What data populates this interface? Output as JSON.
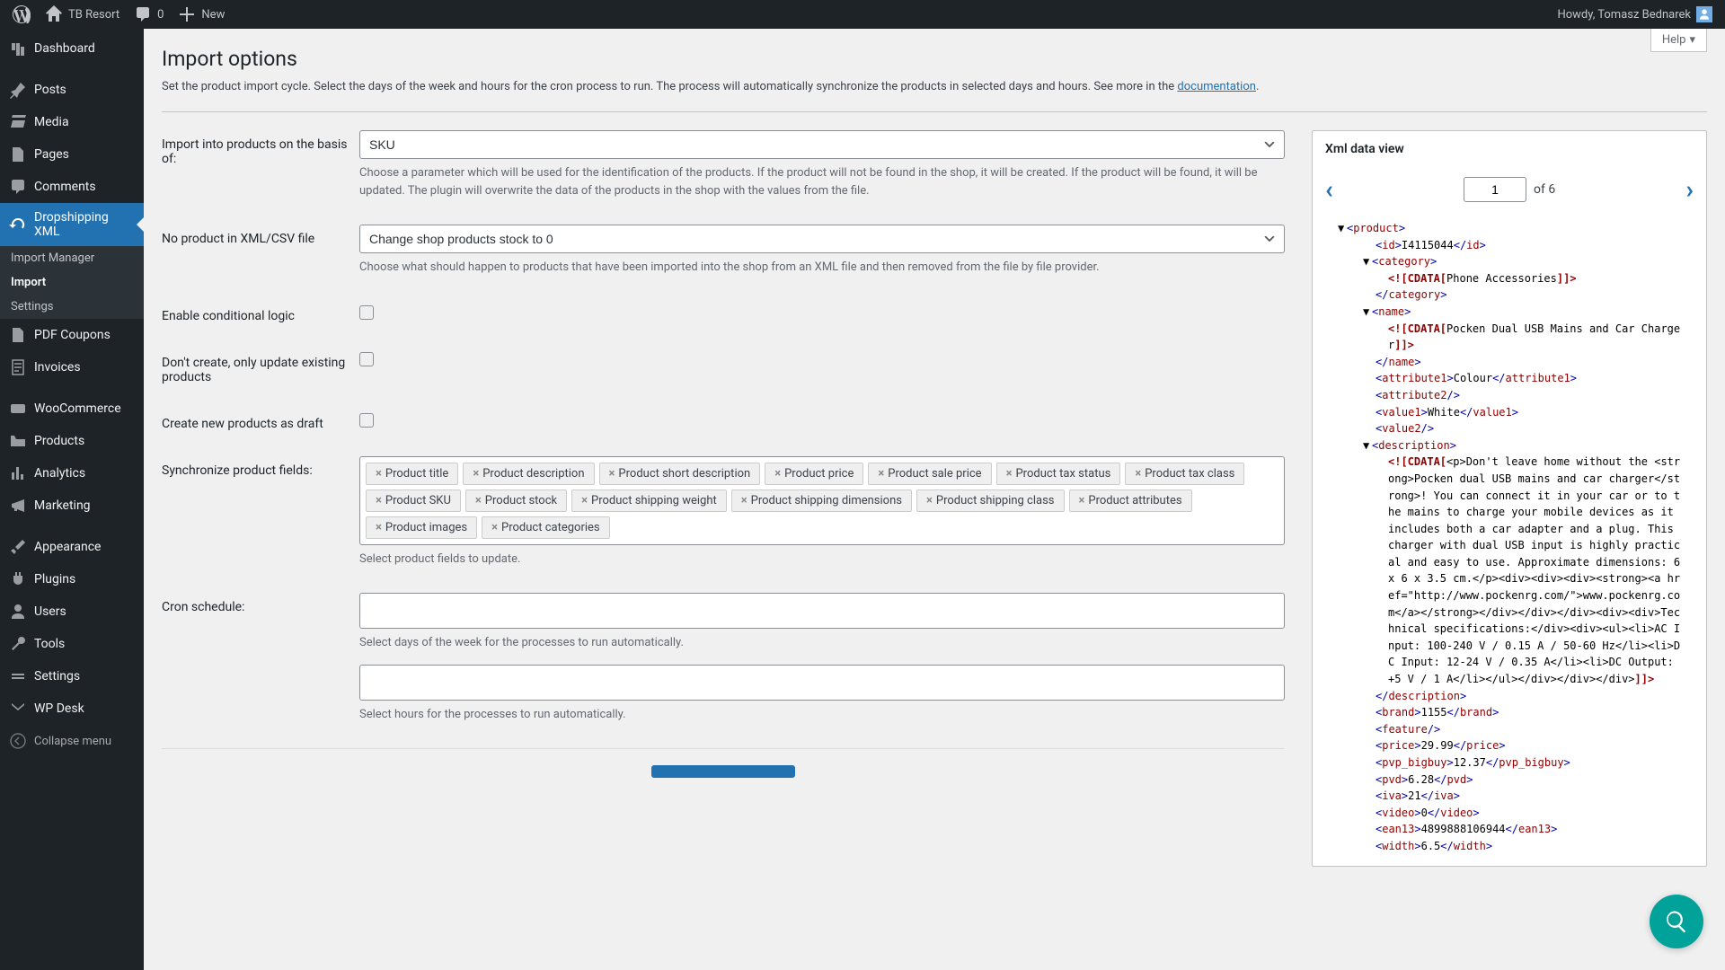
{
  "adminbar": {
    "site_name": "TB Resort",
    "comments_count": "0",
    "new_label": "New",
    "howdy": "Howdy, Tomasz Bednarek"
  },
  "sidebar": {
    "items": [
      {
        "id": "dashboard",
        "label": "Dashboard"
      },
      {
        "id": "posts",
        "label": "Posts"
      },
      {
        "id": "media",
        "label": "Media"
      },
      {
        "id": "pages",
        "label": "Pages"
      },
      {
        "id": "comments",
        "label": "Comments"
      },
      {
        "id": "dropshipping",
        "label": "Dropshipping XML",
        "current": true
      },
      {
        "id": "pdfcoupons",
        "label": "PDF Coupons"
      },
      {
        "id": "invoices",
        "label": "Invoices"
      },
      {
        "id": "woocommerce",
        "label": "WooCommerce"
      },
      {
        "id": "products",
        "label": "Products"
      },
      {
        "id": "analytics",
        "label": "Analytics"
      },
      {
        "id": "marketing",
        "label": "Marketing"
      },
      {
        "id": "appearance",
        "label": "Appearance"
      },
      {
        "id": "plugins",
        "label": "Plugins"
      },
      {
        "id": "users",
        "label": "Users"
      },
      {
        "id": "tools",
        "label": "Tools"
      },
      {
        "id": "settings",
        "label": "Settings"
      },
      {
        "id": "wpdesk",
        "label": "WP Desk"
      }
    ],
    "submenu": [
      {
        "id": "import-manager",
        "label": "Import Manager"
      },
      {
        "id": "import",
        "label": "Import",
        "current": true
      },
      {
        "id": "settings-sub",
        "label": "Settings"
      }
    ],
    "collapse": "Collapse menu"
  },
  "page": {
    "help_label": "Help",
    "title": "Import options",
    "intro_pre": "Set the product import cycle. Select the days of the week and hours for the cron process to run. The process will automatically synchronize the products in selected days and hours. See more in the ",
    "intro_link": "documentation",
    "intro_post": "."
  },
  "form": {
    "basis_label": "Import into products on the basis of:",
    "basis_value": "SKU",
    "basis_help": "Choose a parameter which will be used for the identification of the products. If the product will not be found in the shop, it will be created. If the product will be found, it will be updated. The plugin will overwrite the data of the products in the shop with the values from the file.",
    "noprod_label": "No product in XML/CSV file",
    "noprod_value": "Change shop products stock to 0",
    "noprod_help": "Choose what should happen to products that have been imported into the shop from an XML file and then removed from the file by file provider.",
    "cond_label": "Enable conditional logic",
    "update_label": "Don't create, only update existing products",
    "draft_label": "Create new products as draft",
    "sync_label": "Synchronize product fields:",
    "sync_tags": [
      "Product title",
      "Product description",
      "Product short description",
      "Product price",
      "Product sale price",
      "Product tax status",
      "Product tax class",
      "Product SKU",
      "Product stock",
      "Product shipping weight",
      "Product shipping dimensions",
      "Product shipping class",
      "Product attributes",
      "Product images",
      "Product categories"
    ],
    "sync_help": "Select product fields to update.",
    "cron_label": "Cron schedule:",
    "cron_help1": "Select days of the week for the processes to run automatically.",
    "cron_help2": "Select hours for the processes to run automatically."
  },
  "xml": {
    "title": "Xml data view",
    "page": "1",
    "of_total": "of 6",
    "tree": {
      "product_open": "product",
      "id_val": "I4115044",
      "category_open": "category",
      "cdata_label": "<![CDATA[",
      "cdata_close": "]]>",
      "category_val": "Phone Accessories",
      "name_open": "name",
      "name_val": "Pocken Dual USB Mains and Car Charger",
      "attr1_label": "attribute1",
      "attr1_val": "Colour",
      "attr2_label": "attribute2",
      "value1_label": "value1",
      "value1_val": "White",
      "value2_label": "value2",
      "desc_label": "description",
      "desc_val": "<p>Don't leave home without the <strong>Pocken dual USB mains and car charger</strong>! You can connect it in your car or to the mains to charge your mobile devices as it includes both a car adapter and a plug. This charger with dual USB input is highly practical and easy to use. Approximate dimensions: 6 x 6 x 3.5 cm.</p><div><div><div><strong><a href=\"http://www.pockenrg.com/\">www.pockenrg.com</a></strong></div></div></div><div><div>Technical specifications:</div><div><ul><li>AC Input: 100-240 V / 0.15 A / 50-60 Hz</li><li>DC Input: 12-24 V / 0.35 A</li><li>DC Output: +5 V / 1 A</li></ul></div></div></div>",
      "brand_label": "brand",
      "brand_val": "1155",
      "feature_label": "feature",
      "price_label": "price",
      "price_val": "29.99",
      "pvp_label": "pvp_bigbuy",
      "pvp_val": "12.37",
      "pvd_label": "pvd",
      "pvd_val": "6.28",
      "iva_label": "iva",
      "iva_val": "21",
      "video_label": "video",
      "video_val": "0",
      "ean_label": "ean13",
      "ean_val": "4899888106944",
      "width_label": "width",
      "width_val": "6.5"
    }
  }
}
